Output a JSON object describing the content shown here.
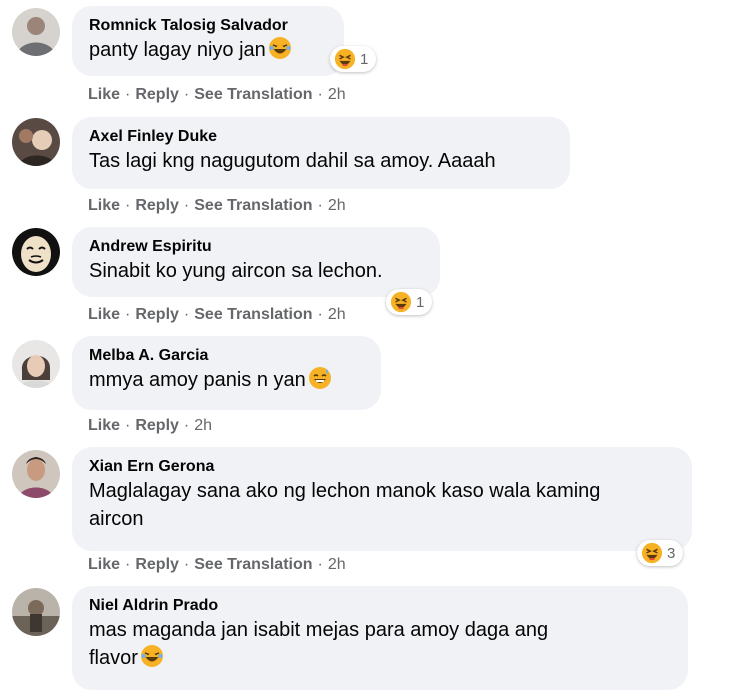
{
  "labels": {
    "like": "Like",
    "reply": "Reply",
    "see_translation": "See Translation",
    "dot": "·"
  },
  "colors": {
    "bubble": "#f0f2f5",
    "action_text": "#65676b",
    "haha_yellow": "#f7b125"
  },
  "comments": [
    {
      "author": "Romnick Talosig Salvador",
      "text_lines": [
        "panty lagay niyo jan"
      ],
      "inline_emoji": "laughing-tears-emoji",
      "reaction_count": "1",
      "time": "2h",
      "has_translation": true
    },
    {
      "author": "Axel Finley Duke",
      "text_lines": [
        "Tas lagi kng nagugutom dahil sa amoy. Aaaah"
      ],
      "time": "2h",
      "has_translation": true
    },
    {
      "author": "Andrew Espiritu",
      "text_lines": [
        "Sinabit ko yung aircon sa lechon."
      ],
      "reaction_count": "1",
      "time": "2h",
      "has_translation": true
    },
    {
      "author": "Melba A. Garcia",
      "text_lines": [
        "mmya amoy panis n yan"
      ],
      "inline_emoji": "grinning-sweat-emoji",
      "time": "2h",
      "has_translation": false
    },
    {
      "author": "Xian Ern Gerona",
      "text_lines": [
        "Maglalagay sana ako ng lechon manok kaso wala kaming",
        "aircon"
      ],
      "reaction_count": "3",
      "time": "2h",
      "has_translation": true
    },
    {
      "author": "Niel Aldrin Prado",
      "text_lines": [
        "mas maganda jan isabit mejas para amoy daga ang",
        "flavor"
      ],
      "inline_emoji": "laughing-tears-emoji",
      "time": "",
      "has_translation": false
    }
  ]
}
